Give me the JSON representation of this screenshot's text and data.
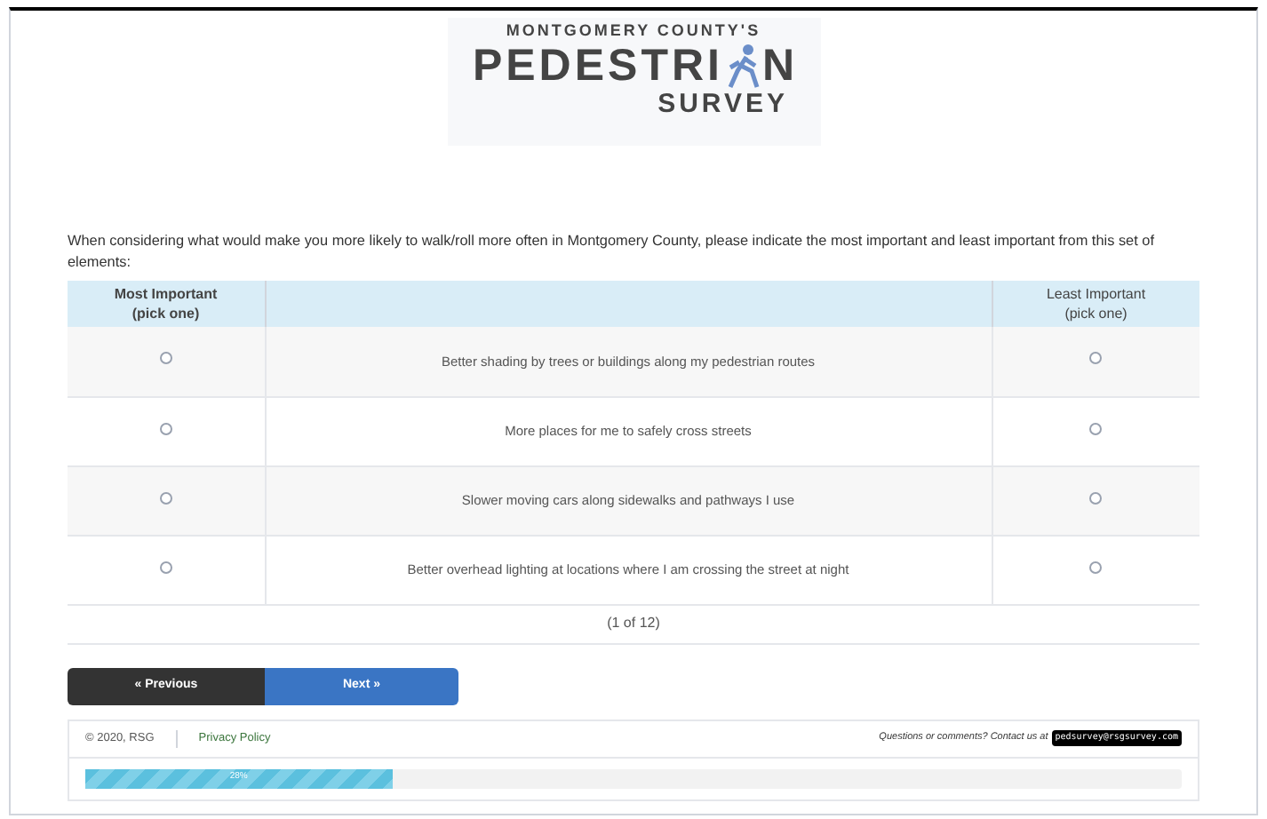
{
  "logo": {
    "line_1": "MONTGOMERY COUNTY'S",
    "line_2_start": "PEDESTRI",
    "line_2_end": "N",
    "line_3": "SURVEY"
  },
  "question": "When considering what would make you more likely to walk/roll more often in Montgomery County, please indicate the most important and least important from this set of elements:",
  "table": {
    "columns": [
      "Most Important\n(pick one)",
      "Least Important\n(pick one)"
    ],
    "rows": [
      {
        "text": "Better shading by trees or buildings along my pedestrian routes",
        "most_selected": false,
        "least_selected": false
      },
      {
        "text": "More places for me to safely cross streets",
        "most_selected": false,
        "least_selected": false
      },
      {
        "text": "Slower moving cars along sidewalks and pathways I use",
        "most_selected": false,
        "least_selected": false
      },
      {
        "text": "Better overhead lighting at locations where I am crossing the street at night",
        "most_selected": false,
        "least_selected": false
      }
    ]
  },
  "pagination": "(1 of 12)",
  "buttons": {
    "previous": "« Previous",
    "next": "Next »"
  },
  "footer": {
    "copyright": "© 2020, RSG",
    "privacy": "Privacy Policy",
    "contact": "Questions or comments? Contact us at",
    "email": "pedsurvey@rsgsurvey.com"
  },
  "progress": {
    "level": 0.28,
    "label": "28%"
  }
}
